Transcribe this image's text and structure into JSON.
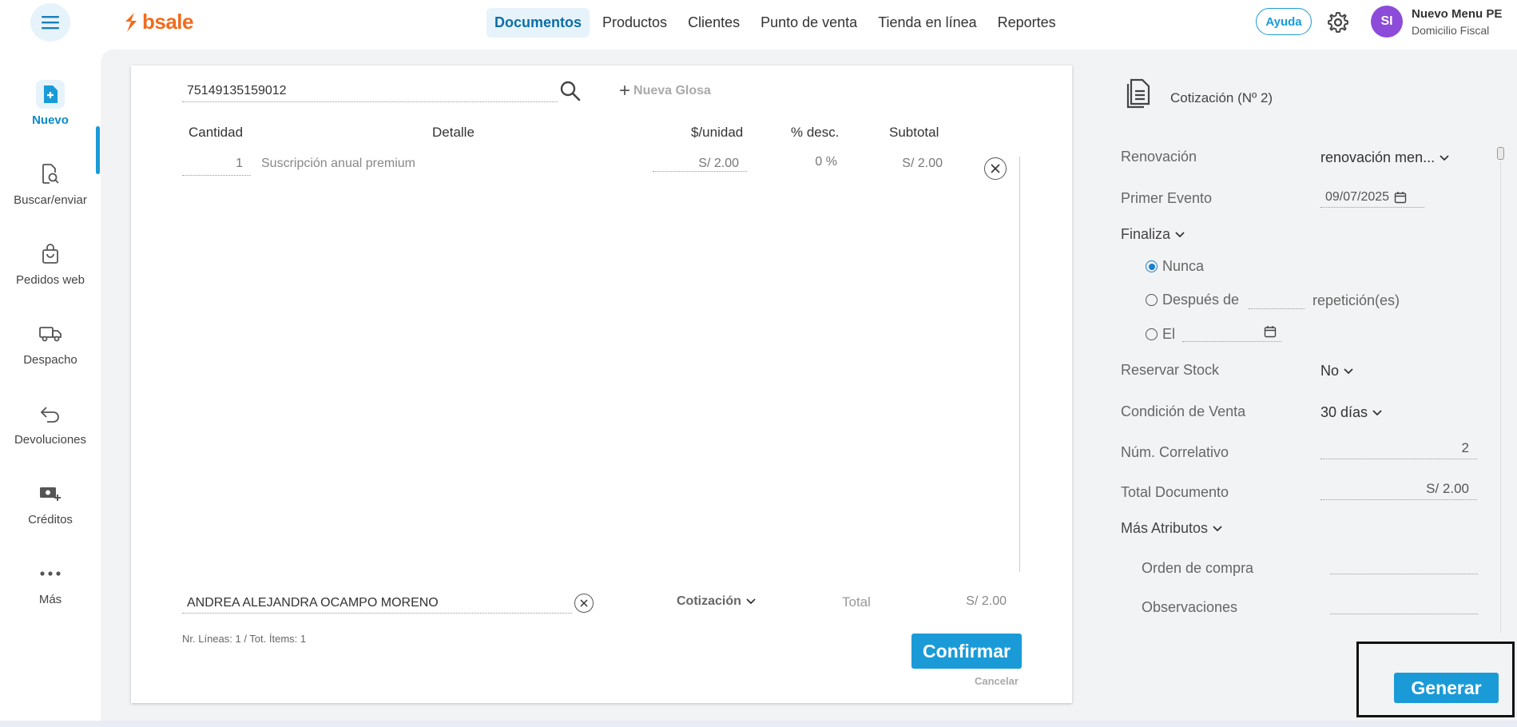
{
  "app": {
    "logo_text": "bsale"
  },
  "nav": {
    "items": [
      "Documentos",
      "Productos",
      "Clientes",
      "Punto de venta",
      "Tienda en línea",
      "Reportes"
    ],
    "active": "Documentos"
  },
  "header": {
    "help_label": "Ayuda",
    "avatar_initials": "SI",
    "user_name": "Nuevo Menu PE",
    "user_sub": "Domicilio Fiscal"
  },
  "sidebar": {
    "items": [
      {
        "label": "Nuevo",
        "icon": "document-plus-icon"
      },
      {
        "label": "Buscar/enviar",
        "icon": "document-search-icon"
      },
      {
        "label": "Pedidos web",
        "icon": "shopping-bag-icon"
      },
      {
        "label": "Despacho",
        "icon": "truck-icon"
      },
      {
        "label": "Devoluciones",
        "icon": "return-arrow-icon"
      },
      {
        "label": "Créditos",
        "icon": "cash-plus-icon"
      },
      {
        "label": "Más",
        "icon": "more-dots-icon"
      }
    ]
  },
  "document": {
    "search_value": "75149135159012",
    "new_glosa_label": "Nueva Glosa",
    "columns": {
      "qty": "Cantidad",
      "detail": "Detalle",
      "unit_price": "$/unidad",
      "discount": "% desc.",
      "subtotal": "Subtotal"
    },
    "rows": [
      {
        "qty": "1",
        "detail": "Suscripción anual premium",
        "unit_price": "S/ 2.00",
        "discount": "0 %",
        "subtotal": "S/ 2.00"
      }
    ],
    "client_name": "ANDREA ALEJANDRA OCAMPO MORENO",
    "doc_type": "Cotización",
    "total_label": "Total",
    "total_value": "S/ 2.00",
    "lines_info": "Nr. Líneas: 1 / Tot. Ítems: 1",
    "confirm_label": "Confirmar",
    "cancel_label": "Cancelar"
  },
  "panel": {
    "title": "Cotización (Nº 2)",
    "renovacion_label": "Renovación",
    "renovacion_value": "renovación men...",
    "primer_evento_label": "Primer Evento",
    "primer_evento_value": "09/07/2025",
    "finaliza_label": "Finaliza",
    "opt_nunca": "Nunca",
    "opt_despues": "Después de",
    "opt_repeticion": "repetición(es)",
    "opt_el": "El",
    "reservar_label": "Reservar Stock",
    "reservar_value": "No",
    "condicion_label": "Condición de Venta",
    "condicion_value": "30 días",
    "correlativo_label": "Núm. Correlativo",
    "correlativo_value": "2",
    "total_doc_label": "Total Documento",
    "total_doc_value": "S/ 2.00",
    "mas_atributos_label": "Más Atributos",
    "orden_label": "Orden de compra",
    "observaciones_label": "Observaciones",
    "generate_label": "Generar"
  },
  "colors": {
    "accent": "#1a9bd7",
    "brand": "#f26b1d",
    "avatar": "#8c4bd8"
  }
}
